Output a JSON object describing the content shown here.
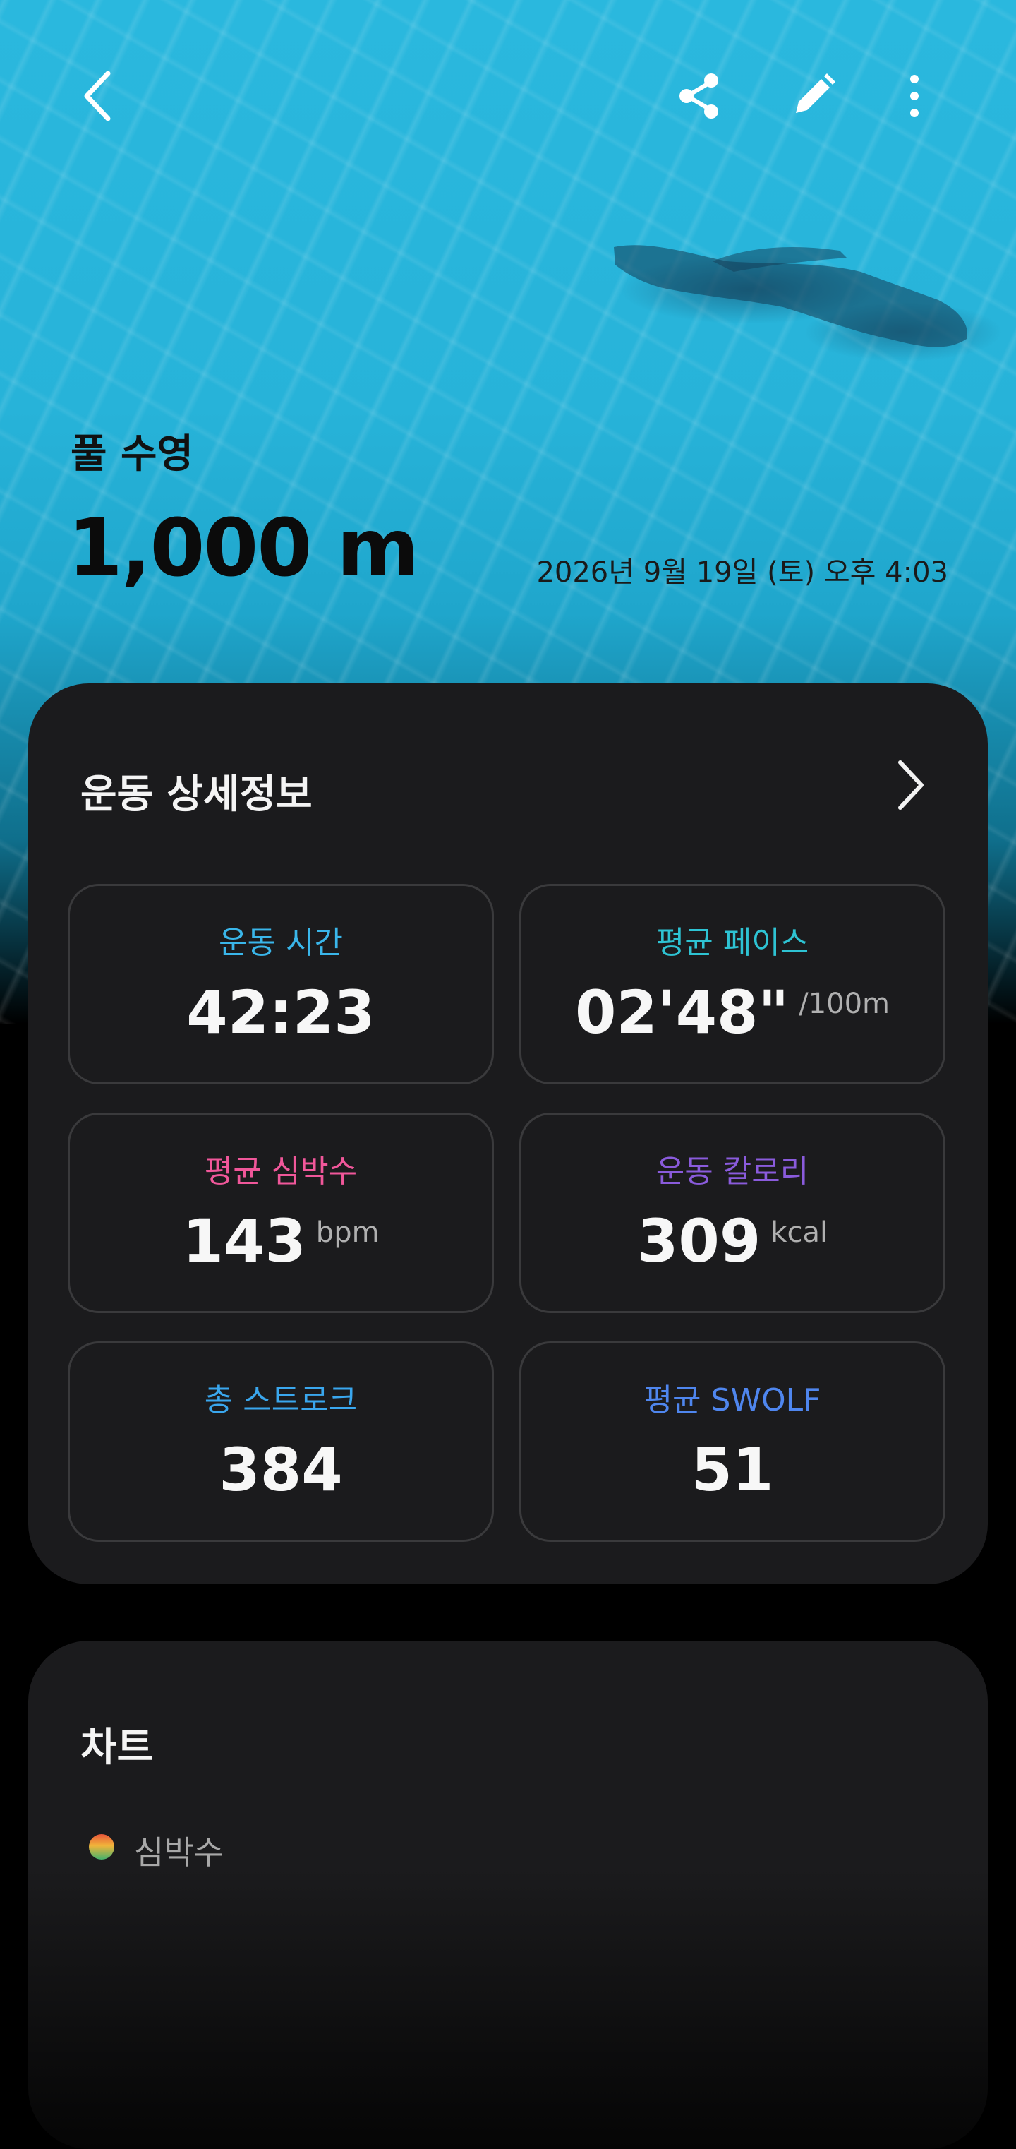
{
  "workout": {
    "type": "풀 수영",
    "distance": "1,000 m",
    "datetime": "2026년 9월 19일 (토) 오후 4:03"
  },
  "icons": {
    "back": "back-arrow-icon",
    "share": "share-icon",
    "edit": "pencil-icon",
    "more": "more-vertical-icon",
    "detail_chevron": "chevron-right-icon"
  },
  "details": {
    "title": "운동 상세정보",
    "tiles": [
      {
        "label": "운동 시간",
        "value": "42:23",
        "unit": "",
        "label_color": "#3ab6ea"
      },
      {
        "label": "평균 페이스",
        "value": "02'48\"",
        "unit": "/100m",
        "label_color": "#2ec3d3"
      },
      {
        "label": "평균 심박수",
        "value": "143",
        "unit": "bpm",
        "label_color": "#f0579a"
      },
      {
        "label": "운동 칼로리",
        "value": "309",
        "unit": "kcal",
        "label_color": "#8a5bdc"
      },
      {
        "label": "총 스트로크",
        "value": "384",
        "unit": "",
        "label_color": "#3aa7ee"
      },
      {
        "label": "평균 SWOLF",
        "value": "51",
        "unit": "",
        "label_color": "#4f86ee"
      }
    ]
  },
  "chart_card": {
    "title": "차트",
    "legend": "심박수"
  },
  "colors": {
    "card_bg": "#1b1b1d",
    "tile_border": "#3a3a3c",
    "water": "#2ab8de"
  }
}
